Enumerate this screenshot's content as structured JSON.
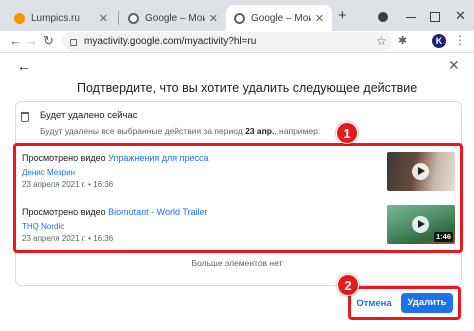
{
  "browser": {
    "tabs": [
      {
        "label": "Lumpics.ru",
        "favicon": "orange-circle-icon"
      },
      {
        "label": "Google – Мои действия",
        "favicon": "google-icon"
      },
      {
        "label": "Google – Мои действия",
        "favicon": "google-icon"
      }
    ],
    "new_tab": "+",
    "url": "myactivity.google.com/myactivity?hl=ru",
    "avatar_letter": "K"
  },
  "dialog": {
    "title": "Подтвердите, что вы хотите удалить следующее действие",
    "info_title": "Будет удалено сейчас",
    "info_text_prefix": "Будут удалены все выбранные действия за период ",
    "info_text_date": "23 апр.",
    "info_text_suffix": ", например:",
    "items": [
      {
        "prefix": "Просмотрено видео ",
        "title": "Упражнения для пресса",
        "channel": "Денис Мезрин",
        "meta": "23 апреля 2021 г. • 16:36",
        "duration": ""
      },
      {
        "prefix": "Просмотрено видео ",
        "title": "Biomutant - World Trailer",
        "channel": "THQ Nordic",
        "meta": "23 апреля 2021 г. • 16:36",
        "duration": "1:46"
      }
    ],
    "no_more": "Больше элементов нет",
    "cancel_label": "Отмена",
    "delete_label": "Удалить"
  },
  "annotations": {
    "badge_1": "1",
    "badge_2": "2",
    "color": "#e8191e"
  },
  "colors": {
    "accent": "#1a73e8",
    "tabstrip": "#dee1e6"
  }
}
